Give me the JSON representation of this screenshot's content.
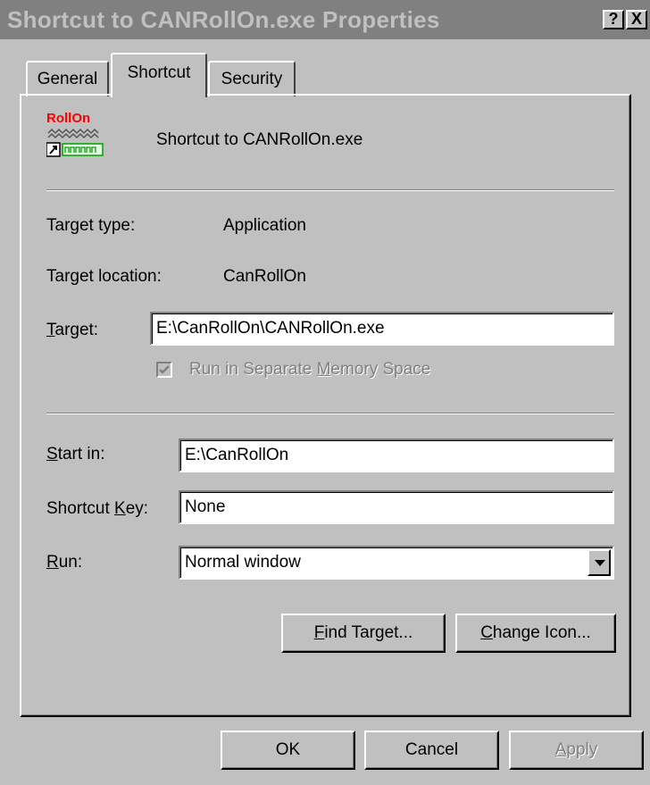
{
  "window": {
    "title": "Shortcut to CANRollOn.exe Properties",
    "help_button": "?",
    "close_button": "X"
  },
  "tabs": [
    {
      "label": "General",
      "selected": false
    },
    {
      "label": "Shortcut",
      "selected": true
    },
    {
      "label": "Security",
      "selected": false
    }
  ],
  "header": {
    "icon_text": "RollOn",
    "shortcut_name": "Shortcut to CANRollOn.exe"
  },
  "fields": {
    "target_type_label": "Target type:",
    "target_type_value": "Application",
    "target_location_label": "Target location:",
    "target_location_value": "CanRollOn",
    "target_label_prefix": "",
    "target_label_ul": "T",
    "target_label_rest": "arget:",
    "target_value": "E:\\CanRollOn\\CANRollOn.exe",
    "run_separate_prefix": "Run in Separate ",
    "run_separate_ul": "M",
    "run_separate_rest": "emory Space",
    "run_separate_checked": true,
    "run_separate_enabled": false,
    "start_in_prefix": "",
    "start_in_ul": "S",
    "start_in_rest": "tart in:",
    "start_in_value": "E:\\CanRollOn",
    "shortcut_key_prefix": "Shortcut ",
    "shortcut_key_ul": "K",
    "shortcut_key_rest": "ey:",
    "shortcut_key_value": "None",
    "run_prefix": "",
    "run_ul": "R",
    "run_rest": "un:",
    "run_value": "Normal window"
  },
  "buttons": {
    "find_target_ul": "F",
    "find_target_rest": "ind Target...",
    "change_icon_ul": "C",
    "change_icon_rest": "hange Icon...",
    "ok": "OK",
    "cancel": "Cancel",
    "apply_ul": "A",
    "apply_rest": "pply"
  },
  "colors": {
    "face": "#c0c0c0",
    "titlebar_inactive": "#808080",
    "icon_red": "#ff0000"
  }
}
